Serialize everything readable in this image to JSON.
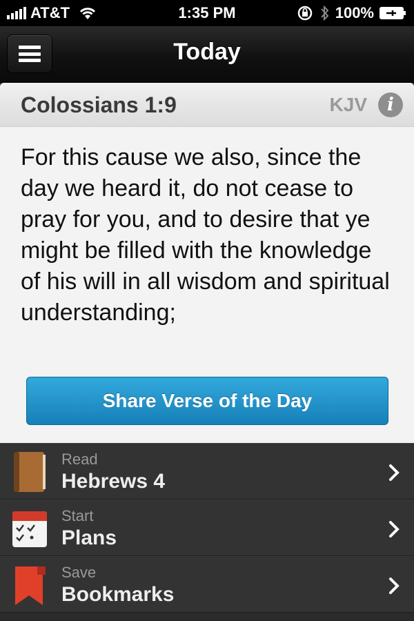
{
  "status_bar": {
    "carrier": "AT&T",
    "time": "1:35 PM",
    "battery": "100%"
  },
  "nav": {
    "title": "Today"
  },
  "verse": {
    "reference": "Colossians 1:9",
    "version": "KJV",
    "info_glyph": "i",
    "text": "For this cause we also, since the day we heard it, do not cease to pray for you, and to desire that ye might be filled with the knowledge of his will in all wisdom and spiritual understanding;",
    "share_label": "Share Verse of the Day"
  },
  "actions": [
    {
      "subtitle": "Read",
      "title": "Hebrews 4",
      "icon": "book-icon"
    },
    {
      "subtitle": "Start",
      "title": "Plans",
      "icon": "calendar-checklist-icon"
    },
    {
      "subtitle": "Save",
      "title": "Bookmarks",
      "icon": "bookmark-icon"
    }
  ],
  "colors": {
    "share_button": "#1e8fc8",
    "book": "#8b5a2b",
    "calendar_top": "#d23a2a",
    "bookmark": "#e0402a"
  }
}
